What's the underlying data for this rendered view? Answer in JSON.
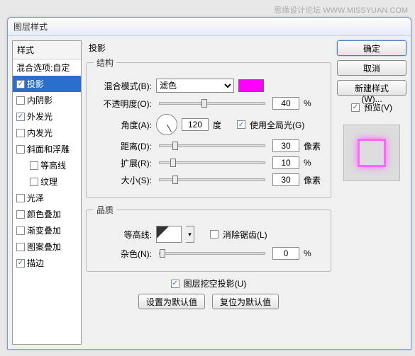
{
  "watermark": "思缘设计论坛  WWW.MISSYUAN.COM",
  "title": "图层样式",
  "sidebar": {
    "header": "样式",
    "items": [
      {
        "label": "混合选项:自定",
        "checked": null
      },
      {
        "label": "投影",
        "checked": true,
        "selected": true
      },
      {
        "label": "内阴影",
        "checked": false
      },
      {
        "label": "外发光",
        "checked": true
      },
      {
        "label": "内发光",
        "checked": false
      },
      {
        "label": "斜面和浮雕",
        "checked": false
      },
      {
        "label": "等高线",
        "checked": false,
        "indent": true
      },
      {
        "label": "纹理",
        "checked": false,
        "indent": true
      },
      {
        "label": "光泽",
        "checked": false
      },
      {
        "label": "颜色叠加",
        "checked": false
      },
      {
        "label": "渐变叠加",
        "checked": false
      },
      {
        "label": "图案叠加",
        "checked": false
      },
      {
        "label": "描边",
        "checked": true
      }
    ]
  },
  "main": {
    "section_title": "投影",
    "structure": {
      "legend": "结构",
      "blend_label": "混合模式(B):",
      "blend_value": "滤色",
      "color": "#ff00ff",
      "opacity_label": "不透明度(O):",
      "opacity_value": "40",
      "opacity_unit": "%",
      "angle_label": "角度(A):",
      "angle_value": "120",
      "angle_unit": "度",
      "global_light_label": "使用全局光(G)",
      "global_light_checked": true,
      "distance_label": "距离(D):",
      "distance_value": "30",
      "distance_unit": "像素",
      "spread_label": "扩展(R):",
      "spread_value": "10",
      "spread_unit": "%",
      "size_label": "大小(S):",
      "size_value": "30",
      "size_unit": "像素"
    },
    "quality": {
      "legend": "品质",
      "contour_label": "等高线:",
      "antialias_label": "消除锯齿(L)",
      "antialias_checked": false,
      "noise_label": "杂色(N):",
      "noise_value": "0",
      "noise_unit": "%"
    },
    "knockout_label": "图层挖空投影(U)",
    "knockout_checked": true,
    "set_default": "设置为默认值",
    "reset_default": "复位为默认值"
  },
  "right": {
    "ok": "确定",
    "cancel": "取消",
    "new_style": "新建样式(W)...",
    "preview_label": "预览(V)",
    "preview_checked": true
  }
}
